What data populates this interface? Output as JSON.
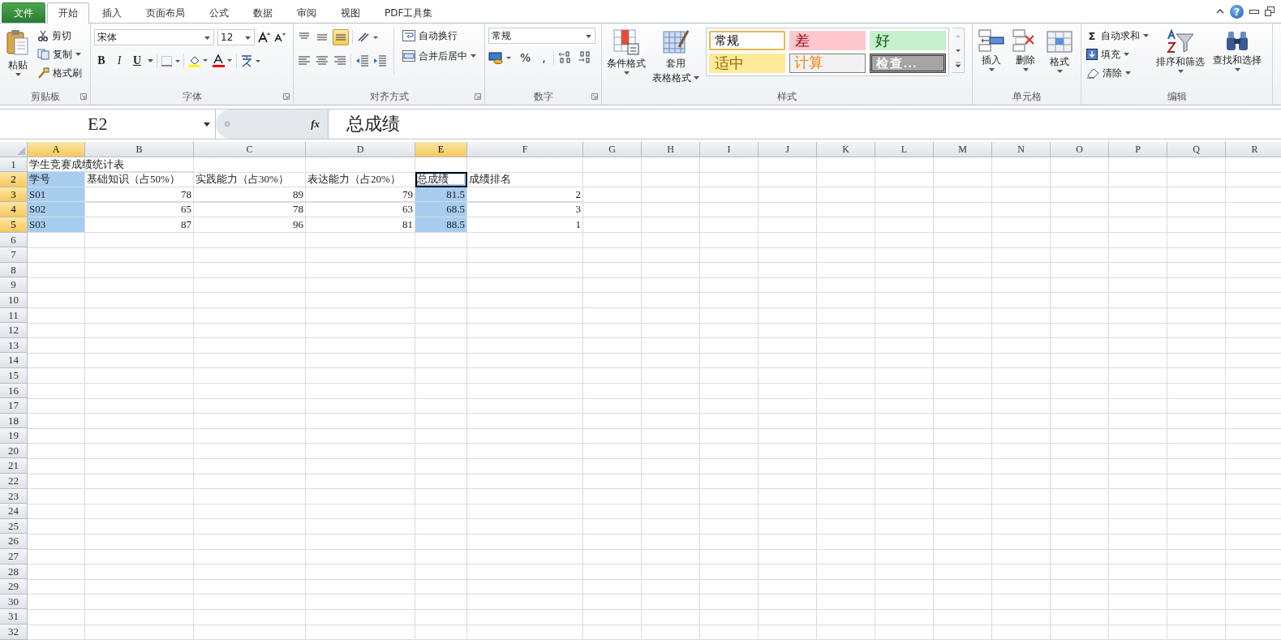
{
  "tabs": [
    {
      "label": "文件",
      "kind": "file",
      "selected": false
    },
    {
      "label": "开始",
      "kind": "tab",
      "selected": true
    },
    {
      "label": "插入",
      "kind": "tab",
      "selected": false
    },
    {
      "label": "页面布局",
      "kind": "tab",
      "selected": false
    },
    {
      "label": "公式",
      "kind": "tab",
      "selected": false
    },
    {
      "label": "数据",
      "kind": "tab",
      "selected": false
    },
    {
      "label": "审阅",
      "kind": "tab",
      "selected": false
    },
    {
      "label": "视图",
      "kind": "tab",
      "selected": false
    },
    {
      "label": "PDF工具集",
      "kind": "tab",
      "selected": false
    }
  ],
  "help": "?",
  "ribbon": {
    "clipboard": {
      "label": "剪贴板",
      "launcher": true,
      "paste": "粘贴",
      "cut": "剪切",
      "copy": "复制",
      "painter": "格式刷"
    },
    "font": {
      "label": "字体",
      "launcher": true,
      "font_name": "宋体",
      "font_size": "12",
      "bold": "B",
      "italic": "I",
      "underline": "U"
    },
    "alignment": {
      "label": "对齐方式",
      "launcher": true,
      "wrap": "自动换行",
      "merge": "合并后居中",
      "bottom_align_on": true
    },
    "number": {
      "label": "数字",
      "launcher": true,
      "format": "常规",
      "percent": "%",
      "comma": ","
    },
    "styles": {
      "label": "样式",
      "launcher": false,
      "conditional": "条件格式",
      "table_lines": [
        "套用",
        "表格格式"
      ],
      "gallery": [
        {
          "label": "常规",
          "kind": "normal",
          "selected": true
        },
        {
          "label": "差",
          "kind": "bad",
          "selected": false
        },
        {
          "label": "好",
          "kind": "good",
          "selected": false
        },
        {
          "label": "适中",
          "kind": "neutral",
          "selected": false
        },
        {
          "label": "计算",
          "kind": "calculation",
          "selected": false
        },
        {
          "label": "检查...",
          "kind": "check",
          "selected": false
        }
      ]
    },
    "cells": {
      "label": "单元格",
      "launcher": false,
      "insert": "插入",
      "delete": "删除",
      "format": "格式"
    },
    "editing": {
      "label": "编辑",
      "launcher": false,
      "sigma": "Σ",
      "autosum": "自动求和",
      "fill": "填充",
      "clear": "清除",
      "sort": "排序和筛选",
      "find": "查找和选择"
    }
  },
  "formula_bar": {
    "name_box": "E2",
    "fx": "fx",
    "content": "总成绩"
  },
  "columns": [
    {
      "label": "A",
      "selected": true
    },
    {
      "label": "B",
      "selected": false
    },
    {
      "label": "C",
      "selected": false
    },
    {
      "label": "D",
      "selected": false
    },
    {
      "label": "E",
      "selected": true
    },
    {
      "label": "F",
      "selected": false
    },
    {
      "label": "G",
      "selected": false
    },
    {
      "label": "H",
      "selected": false
    },
    {
      "label": "I",
      "selected": false
    },
    {
      "label": "J",
      "selected": false
    },
    {
      "label": "K",
      "selected": false
    },
    {
      "label": "L",
      "selected": false
    },
    {
      "label": "M",
      "selected": false
    },
    {
      "label": "N",
      "selected": false
    },
    {
      "label": "O",
      "selected": false
    },
    {
      "label": "P",
      "selected": false
    },
    {
      "label": "Q",
      "selected": false
    },
    {
      "label": "R",
      "selected": false
    }
  ],
  "rows": [
    {
      "label": "1",
      "selected": false,
      "cells": [
        {
          "text": " 学生竞赛成绩统计表",
          "kind": "text",
          "selected": false,
          "active": false
        }
      ]
    },
    {
      "label": "2",
      "selected": true,
      "cells": [
        {
          "text": "学号",
          "kind": "text",
          "selected": true,
          "active": false
        },
        {
          "text": "基础知识（占50%）",
          "kind": "text",
          "selected": false,
          "active": false
        },
        {
          "text": "实践能力（占30%）",
          "kind": "text",
          "selected": false,
          "active": false
        },
        {
          "text": "表达能力（占20%）",
          "kind": "text",
          "selected": false,
          "active": false
        },
        {
          "text": "总成绩",
          "kind": "text",
          "selected": true,
          "active": true
        },
        {
          "text": "成绩排名",
          "kind": "text",
          "selected": false,
          "active": false
        }
      ]
    },
    {
      "label": "3",
      "selected": true,
      "cells": [
        {
          "text": "S01",
          "kind": "text",
          "selected": true,
          "active": false
        },
        {
          "text": "78",
          "kind": "number",
          "selected": false,
          "active": false
        },
        {
          "text": "89",
          "kind": "number",
          "selected": false,
          "active": false
        },
        {
          "text": "79",
          "kind": "number",
          "selected": false,
          "active": false
        },
        {
          "text": "81.5",
          "kind": "number",
          "selected": true,
          "active": false
        },
        {
          "text": "2",
          "kind": "number",
          "selected": false,
          "active": false
        }
      ]
    },
    {
      "label": "4",
      "selected": true,
      "cells": [
        {
          "text": "S02",
          "kind": "text",
          "selected": true,
          "active": false
        },
        {
          "text": "65",
          "kind": "number",
          "selected": false,
          "active": false
        },
        {
          "text": "78",
          "kind": "number",
          "selected": false,
          "active": false
        },
        {
          "text": "63",
          "kind": "number",
          "selected": false,
          "active": false
        },
        {
          "text": "68.5",
          "kind": "number",
          "selected": true,
          "active": false
        },
        {
          "text": "3",
          "kind": "number",
          "selected": false,
          "active": false
        }
      ]
    },
    {
      "label": "5",
      "selected": true,
      "cells": [
        {
          "text": "S03",
          "kind": "text",
          "selected": true,
          "active": false
        },
        {
          "text": "87",
          "kind": "number",
          "selected": false,
          "active": false
        },
        {
          "text": "96",
          "kind": "number",
          "selected": false,
          "active": false
        },
        {
          "text": "81",
          "kind": "number",
          "selected": false,
          "active": false
        },
        {
          "text": "88.5",
          "kind": "number",
          "selected": true,
          "active": false
        },
        {
          "text": "1",
          "kind": "number",
          "selected": false,
          "active": false
        }
      ]
    },
    {
      "label": "6",
      "selected": false,
      "cells": []
    },
    {
      "label": "7",
      "selected": false,
      "cells": []
    },
    {
      "label": "8",
      "selected": false,
      "cells": []
    },
    {
      "label": "9",
      "selected": false,
      "cells": []
    },
    {
      "label": "10",
      "selected": false,
      "cells": []
    },
    {
      "label": "11",
      "selected": false,
      "cells": []
    },
    {
      "label": "12",
      "selected": false,
      "cells": []
    },
    {
      "label": "13",
      "selected": false,
      "cells": []
    },
    {
      "label": "14",
      "selected": false,
      "cells": []
    },
    {
      "label": "15",
      "selected": false,
      "cells": []
    },
    {
      "label": "16",
      "selected": false,
      "cells": []
    },
    {
      "label": "17",
      "selected": false,
      "cells": []
    },
    {
      "label": "18",
      "selected": false,
      "cells": []
    },
    {
      "label": "19",
      "selected": false,
      "cells": []
    },
    {
      "label": "20",
      "selected": false,
      "cells": []
    },
    {
      "label": "21",
      "selected": false,
      "cells": []
    },
    {
      "label": "22",
      "selected": false,
      "cells": []
    },
    {
      "label": "23",
      "selected": false,
      "cells": []
    },
    {
      "label": "24",
      "selected": false,
      "cells": []
    },
    {
      "label": "25",
      "selected": false,
      "cells": []
    },
    {
      "label": "26",
      "selected": false,
      "cells": []
    },
    {
      "label": "27",
      "selected": false,
      "cells": []
    },
    {
      "label": "28",
      "selected": false,
      "cells": []
    },
    {
      "label": "29",
      "selected": false,
      "cells": []
    },
    {
      "label": "30",
      "selected": false,
      "cells": []
    },
    {
      "label": "31",
      "selected": false,
      "cells": []
    },
    {
      "label": "32",
      "selected": false,
      "cells": []
    }
  ]
}
